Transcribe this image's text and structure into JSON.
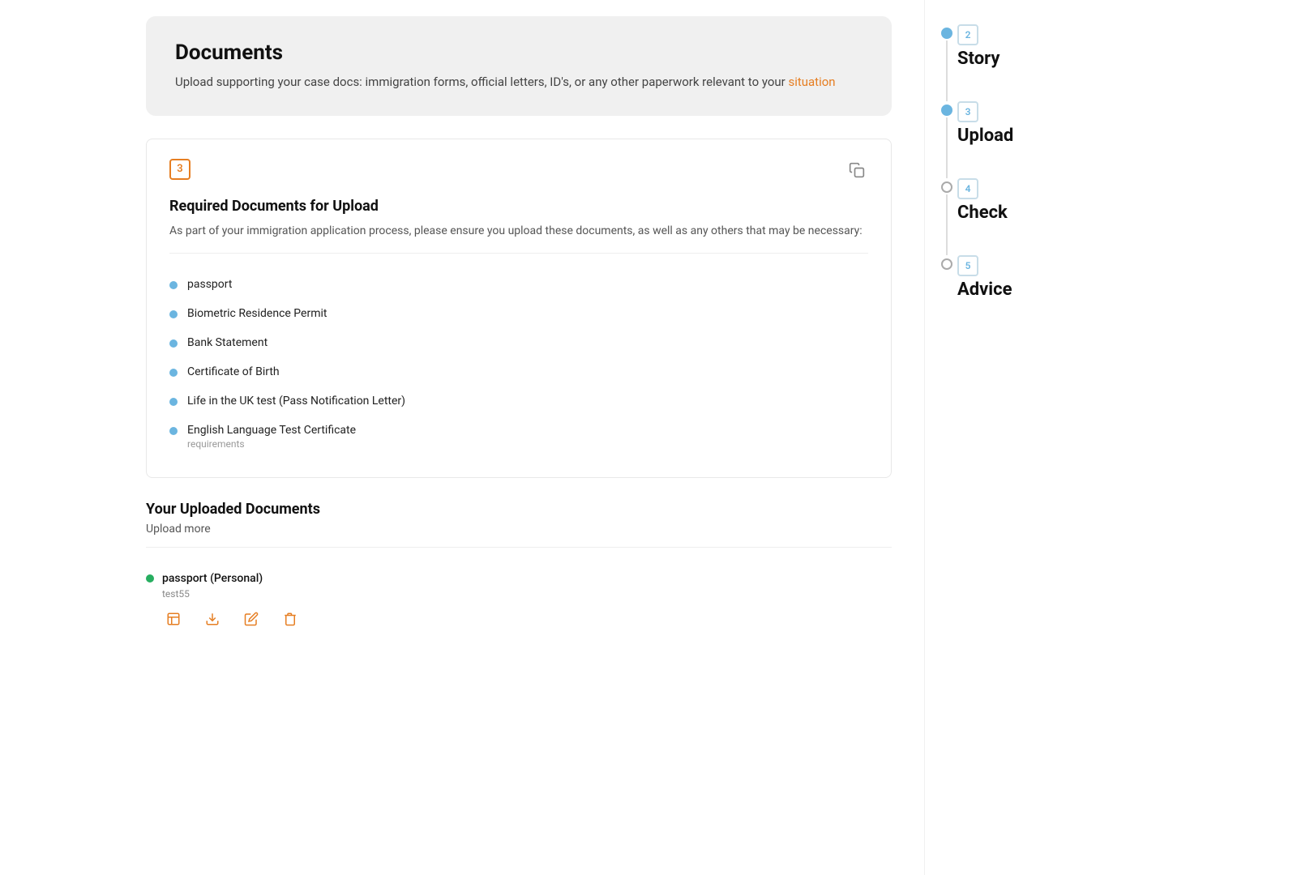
{
  "page": {
    "title": "Documents"
  },
  "header_card": {
    "title": "Documents",
    "description_start": "Upload supporting your case docs: immigration forms, official letters, ID's, or any other paperwork relevant to your ",
    "link_text": "situation",
    "description_end": ""
  },
  "required_section": {
    "step_number": "3",
    "heading": "Required Documents for Upload",
    "description": "As part of your immigration application process, please ensure you upload these documents, as well as any others that may be necessary:",
    "documents": [
      {
        "name": "passport",
        "sub_text": ""
      },
      {
        "name": "Biometric Residence Permit",
        "sub_text": ""
      },
      {
        "name": "Bank Statement",
        "sub_text": ""
      },
      {
        "name": "Certificate of Birth",
        "sub_text": ""
      },
      {
        "name": "Life in the UK test (Pass Notification Letter)",
        "sub_text": ""
      },
      {
        "name": "English Language Test Certificate",
        "sub_text": "requirements"
      }
    ]
  },
  "uploaded_section": {
    "heading": "Your Uploaded Documents",
    "upload_more_label": "Upload more",
    "documents": [
      {
        "name": "passport (Personal)",
        "filename": "test55",
        "status": "green"
      }
    ]
  },
  "sidebar": {
    "steps": [
      {
        "number": "2",
        "label": "Story",
        "dot_active": true
      },
      {
        "number": "3",
        "label": "Upload",
        "dot_active": true
      },
      {
        "number": "4",
        "label": "Check",
        "dot_active": false
      },
      {
        "number": "5",
        "label": "Advice",
        "dot_active": false
      }
    ]
  },
  "icons": {
    "copy": "⧉",
    "download": "↓",
    "edit": "✎",
    "delete": "🗑",
    "view": "👁"
  }
}
